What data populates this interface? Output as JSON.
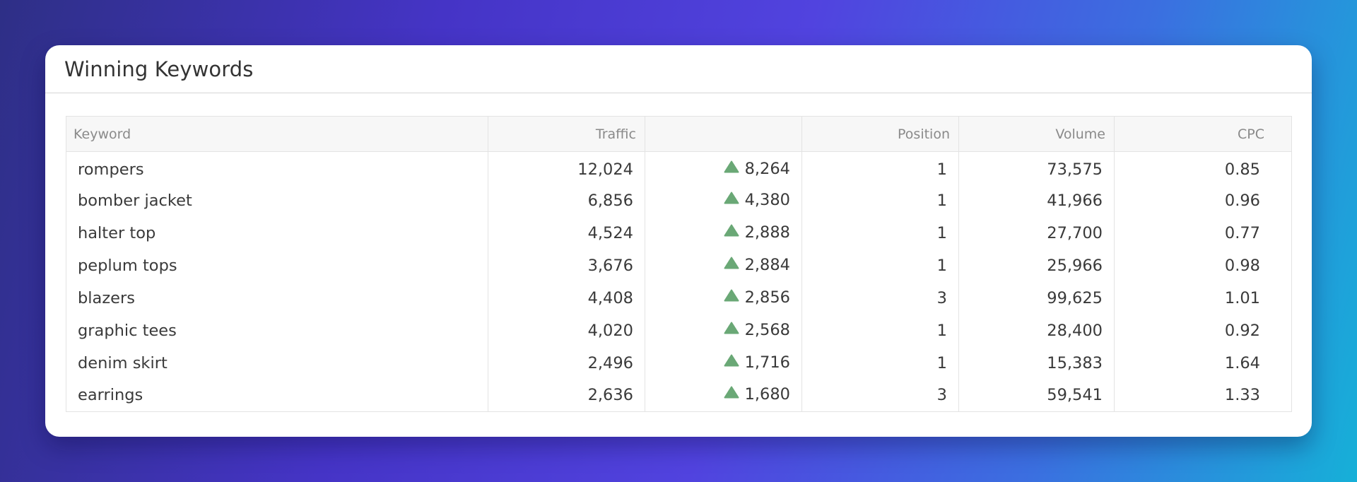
{
  "widget": {
    "title": "Winning Keywords"
  },
  "colors": {
    "up_arrow": "#6aa876"
  },
  "table": {
    "columns": {
      "keyword": "Keyword",
      "traffic": "Traffic",
      "change": "",
      "position": "Position",
      "volume": "Volume",
      "cpc": "CPC"
    },
    "rows": [
      {
        "keyword": "rompers",
        "traffic": "12,024",
        "change": "8,264",
        "change_icon": "triangle-up-icon",
        "position": "1",
        "volume": "73,575",
        "cpc": "0.85"
      },
      {
        "keyword": "bomber jacket",
        "traffic": "6,856",
        "change": "4,380",
        "change_icon": "triangle-up-icon",
        "position": "1",
        "volume": "41,966",
        "cpc": "0.96"
      },
      {
        "keyword": "halter top",
        "traffic": "4,524",
        "change": "2,888",
        "change_icon": "triangle-up-icon",
        "position": "1",
        "volume": "27,700",
        "cpc": "0.77"
      },
      {
        "keyword": "peplum tops",
        "traffic": "3,676",
        "change": "2,884",
        "change_icon": "triangle-up-icon",
        "position": "1",
        "volume": "25,966",
        "cpc": "0.98"
      },
      {
        "keyword": "blazers",
        "traffic": "4,408",
        "change": "2,856",
        "change_icon": "triangle-up-icon",
        "position": "3",
        "volume": "99,625",
        "cpc": "1.01"
      },
      {
        "keyword": "graphic tees",
        "traffic": "4,020",
        "change": "2,568",
        "change_icon": "triangle-up-icon",
        "position": "1",
        "volume": "28,400",
        "cpc": "0.92"
      },
      {
        "keyword": "denim skirt",
        "traffic": "2,496",
        "change": "1,716",
        "change_icon": "triangle-up-icon",
        "position": "1",
        "volume": "15,383",
        "cpc": "1.64"
      },
      {
        "keyword": "earrings",
        "traffic": "2,636",
        "change": "1,680",
        "change_icon": "triangle-up-icon",
        "position": "3",
        "volume": "59,541",
        "cpc": "1.33"
      }
    ]
  }
}
